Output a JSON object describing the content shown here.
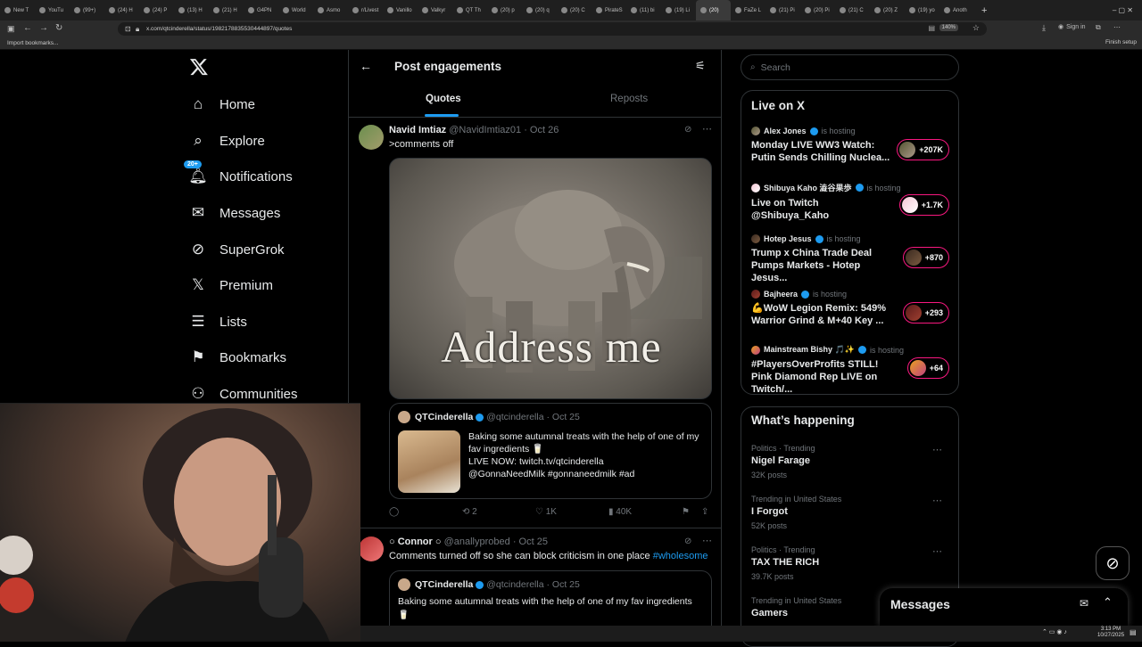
{
  "browser": {
    "tabs": [
      "New T",
      "YouTu",
      "(99+)",
      "(24) H",
      "(24) P",
      "(13) H",
      "(21) H",
      "G4PN",
      "World",
      "Asmo",
      "r/Livest",
      "Vanillo",
      "Valkyr",
      "QT Th",
      "(20) p",
      "(20) q",
      "(20) C",
      "PirateS",
      "(11) bi",
      "(19) Li",
      "(20)",
      "FaZe L",
      "(21) Pi",
      "(20) Pi",
      "(21) C",
      "(20) Z",
      "(19) yo",
      "Anoth"
    ],
    "url": "x.com/qtcinderella/status/1982178835530444897/quotes",
    "zoom": "140%",
    "sign_in": "Sign in",
    "finish_setup": "Finish setup",
    "bookmarks_label": "Import bookmarks..."
  },
  "nav": {
    "items": [
      {
        "label": "Home",
        "icon": "home-icon"
      },
      {
        "label": "Explore",
        "icon": "search-icon"
      },
      {
        "label": "Notifications",
        "icon": "bell-icon",
        "badge": "20+"
      },
      {
        "label": "Messages",
        "icon": "mail-icon"
      },
      {
        "label": "SuperGrok",
        "icon": "grok-icon"
      },
      {
        "label": "Premium",
        "icon": "x-logo-icon"
      },
      {
        "label": "Lists",
        "icon": "list-icon"
      },
      {
        "label": "Bookmarks",
        "icon": "bookmark-icon"
      },
      {
        "label": "Communities",
        "icon": "people-icon"
      }
    ]
  },
  "header": {
    "title": "Post engagements",
    "tabs": [
      "Quotes",
      "Reposts"
    ]
  },
  "post1": {
    "name": "Navid Imtiaz",
    "handle": "@NavidImtiaz01",
    "date": "· Oct 26",
    "text": ">comments off",
    "media_caption": "Address me",
    "quote": {
      "name": "QTCinderella",
      "handle": "@qtcinderella",
      "date": "· Oct 25",
      "text_1": "Baking some autumnal treats with the help of one of my fav ingredients 🥛",
      "text_2": "LIVE NOW: twitch.tv/qtcinderella",
      "text_3": "@GonnaNeedMilk  #gonnaneedmilk #ad"
    },
    "stats": {
      "reposts": "2",
      "likes": "1K",
      "views": "40K"
    }
  },
  "post2": {
    "name": "Connor",
    "handle": "@anallyprobed",
    "date": "· Oct 25",
    "text": "Comments turned off so she can block criticism in one place",
    "hashtag": "#wholesome",
    "quote": {
      "name": "QTCinderella",
      "handle": "@qtcinderella",
      "date": "· Oct 25",
      "text": "Baking some autumnal treats with the help of one of my fav ingredients"
    }
  },
  "search": {
    "placeholder": "Search"
  },
  "live": {
    "title": "Live on X",
    "hosting_label": "is hosting",
    "items": [
      {
        "host": "Alex Jones",
        "title": "Monday LIVE WW3 Watch: Putin Sends Chilling Nuclea...",
        "count": "+207K"
      },
      {
        "host": "Shibuya Kaho 澁谷果歩",
        "title": "Live on Twitch @Shibuya_Kaho",
        "count": "+1.7K"
      },
      {
        "host": "Hotep Jesus",
        "title": "Trump x China Trade Deal Pumps Markets - Hotep Jesus...",
        "count": "+870"
      },
      {
        "host": "Bajheera",
        "title": "💪WoW Legion Remix: 549% Warrior Grind & M+40 Key ...",
        "count": "+293"
      },
      {
        "host": "Mainstream Bishy 🎵✨",
        "title": "#PlayersOverProfits STILL! Pink Diamond Rep LIVE on Twitch/...",
        "count": "+64"
      }
    ]
  },
  "happening": {
    "title": "What’s happening",
    "items": [
      {
        "category": "Politics · Trending",
        "name": "Nigel Farage",
        "count": "32K posts"
      },
      {
        "category": "Trending in United States",
        "name": "I Forgot",
        "count": "52K posts"
      },
      {
        "category": "Politics · Trending",
        "name": "TAX THE RICH",
        "count": "39.7K posts"
      },
      {
        "category": "Trending in United States",
        "name": "Gamers",
        "count": ""
      }
    ]
  },
  "messages_dock": {
    "title": "Messages"
  },
  "taskbar": {
    "time": "3:13 PM",
    "date": "10/27/2025"
  },
  "colors": {
    "accent": "#1d9bf0",
    "live": "#f91880",
    "border": "#2f3336",
    "muted": "#71767b"
  }
}
